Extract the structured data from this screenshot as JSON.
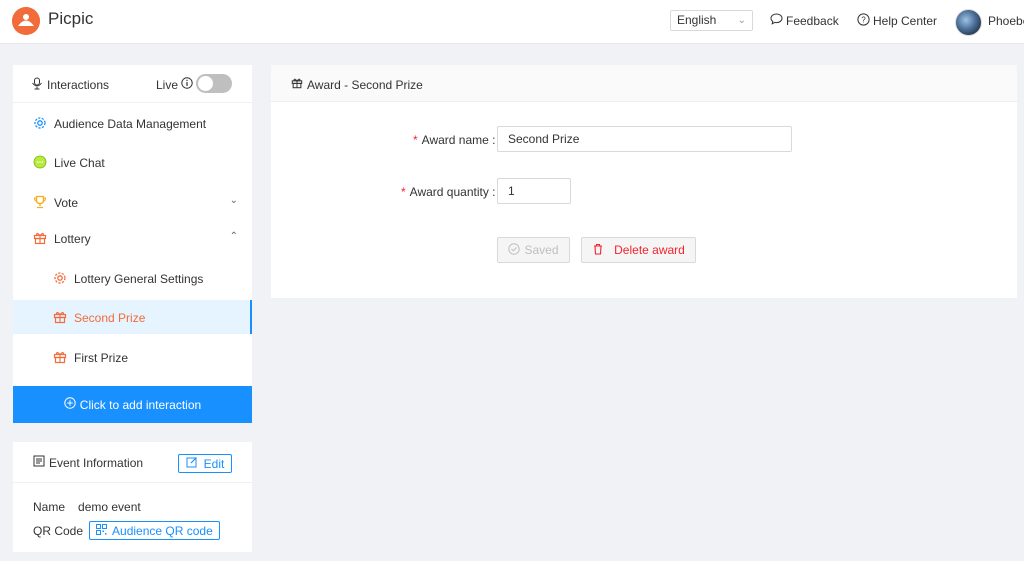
{
  "topbar": {
    "app_name": "Picpic",
    "language": "English",
    "feedback": "Feedback",
    "help_center": "Help Center",
    "username": "Phoebe"
  },
  "sidebar": {
    "header_title": "Interactions",
    "live_label": "Live",
    "live_enabled": false,
    "items": [
      {
        "label": "Audience Data Management",
        "icon": "gear-icon"
      },
      {
        "label": "Live Chat",
        "icon": "chat-icon"
      },
      {
        "label": "Vote",
        "icon": "trophy-icon"
      },
      {
        "label": "Lottery",
        "icon": "gift-icon"
      }
    ],
    "sub_items": [
      {
        "label": "Lottery General Settings",
        "icon": "gear-icon"
      },
      {
        "label": "Second Prize",
        "icon": "gift-icon",
        "active": true
      },
      {
        "label": "First Prize",
        "icon": "gift-icon"
      }
    ],
    "add_button": "Click to add interaction"
  },
  "event_info": {
    "title": "Event Information",
    "edit_label": "Edit",
    "name_key": "Name",
    "name_value": "demo event",
    "qr_key": "QR Code",
    "qr_button": "Audience QR code"
  },
  "main": {
    "header_title": "Award - Second Prize",
    "award_name_label": "Award name",
    "award_name_value": "Second Prize",
    "award_quantity_label": "Award quantity",
    "award_quantity_value": "1",
    "saved_label": "Saved",
    "delete_label": "Delete award"
  },
  "colors": {
    "accent": "#1890ff",
    "brand": "#f26b3a",
    "danger": "#f5222d"
  }
}
